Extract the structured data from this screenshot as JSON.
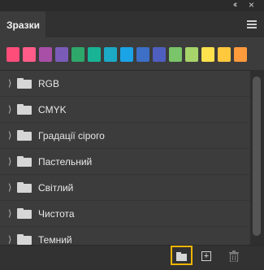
{
  "panel": {
    "tab_label": "Зразки",
    "collapse_icon": "double-chevron-right-icon",
    "close_icon": "close-icon",
    "menu_icon": "hamburger-menu-icon"
  },
  "recent_swatches": [
    "#ff4d7a",
    "#ff5c8a",
    "#a84fa8",
    "#7a5cb8",
    "#2ea86a",
    "#19b496",
    "#1ba9c6",
    "#1aa3e6",
    "#3d6fc6",
    "#4f5fbf",
    "#7ac46a",
    "#a6d36a",
    "#ffe24d",
    "#ffc83d",
    "#ff9a3d"
  ],
  "groups": [
    {
      "label": "RGB"
    },
    {
      "label": "CMYK"
    },
    {
      "label": "Градації сірого"
    },
    {
      "label": "Пастельний"
    },
    {
      "label": "Світлий"
    },
    {
      "label": "Чистота"
    },
    {
      "label": "Темний"
    }
  ],
  "bottom": {
    "new_group_icon": "new-group-folder-icon",
    "new_swatch_icon": "add-icon",
    "delete_icon": "trash-icon",
    "highlight_color": "#f0b400"
  }
}
